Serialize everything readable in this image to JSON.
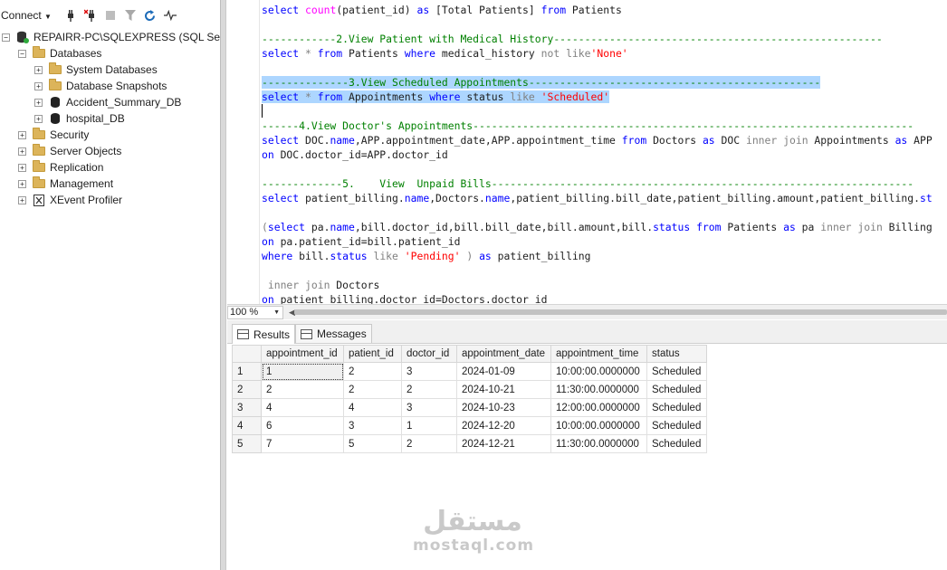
{
  "explorer": {
    "connect_label": "Connect",
    "toolbar_icons": [
      "connect-plug-icon",
      "disconnect-plug-icon",
      "stop-icon",
      "filter-icon",
      "refresh-icon",
      "activity-monitor-icon"
    ],
    "server": "REPAIRR-PC\\SQLEXPRESS (SQL Server",
    "databases_label": "Databases",
    "databases": [
      "System Databases",
      "Database Snapshots",
      "Accident_Summary_DB",
      "hospital_DB"
    ],
    "folders": [
      "Security",
      "Server Objects",
      "Replication",
      "Management"
    ],
    "xevent_label": "XEvent Profiler"
  },
  "editor": {
    "lines": [
      [
        "select ",
        "count",
        "(patient_id) ",
        "as",
        " [Total Patients] ",
        "from",
        " Patients"
      ],
      [
        "------------2.View Patient with Medical History-----------------------------------------------------"
      ],
      [
        "select ",
        "*",
        " from",
        " Patients ",
        "where",
        " medical_history ",
        "not like",
        "'None'"
      ],
      [
        "--------------3.View Scheduled Appointments-----------------------------------------------"
      ],
      [
        "select ",
        "*",
        " from",
        " Appointments ",
        "where",
        " status ",
        "like",
        " 'Scheduled'"
      ],
      [
        "------4.View Doctor's Appointments-----------------------------------------------------------------------"
      ],
      [
        "select",
        " DOC.",
        "name",
        ",APP.appointment_date,APP.appointment_time ",
        "from",
        " Doctors ",
        "as",
        " DOC ",
        "inner join",
        " Appointments ",
        "as",
        " APP"
      ],
      [
        "on",
        " DOC.doctor_id=APP.doctor_id"
      ],
      [
        "-------------5.    View  Unpaid Bills--------------------------------------------------------------------"
      ],
      [
        "select",
        " patient_billing.",
        "name",
        ",Doctors.",
        "name",
        ",patient_billing.bill_date,patient_billing.amount,patient_billing.",
        "st"
      ],
      [
        "(",
        "select",
        " pa.",
        "name",
        ",bill.doctor_id,bill.bill_date,bill.amount,bill.",
        "status",
        " ",
        "from",
        " Patients ",
        "as",
        " pa ",
        "inner join",
        " Billing"
      ],
      [
        "on",
        " pa.patient_id=bill.patient_id"
      ],
      [
        "where",
        " bill.",
        "status",
        " ",
        "like",
        " ",
        "'Pending'",
        " ) ",
        "as",
        " patient_billing"
      ],
      [
        " ",
        "inner join",
        " Doctors"
      ],
      [
        "on",
        " patient_billing.doctor_id=Doctors.doctor_id"
      ]
    ]
  },
  "zoom": {
    "value": "100 %"
  },
  "results": {
    "tabs": [
      "Results",
      "Messages"
    ],
    "columns": [
      "appointment_id",
      "patient_id",
      "doctor_id",
      "appointment_date",
      "appointment_time",
      "status"
    ],
    "rows": [
      [
        "1",
        "1",
        "2",
        "3",
        "2024-01-09",
        "10:00:00.0000000",
        "Scheduled"
      ],
      [
        "2",
        "2",
        "2",
        "2",
        "2024-10-21",
        "11:30:00.0000000",
        "Scheduled"
      ],
      [
        "3",
        "4",
        "4",
        "3",
        "2024-10-23",
        "12:00:00.0000000",
        "Scheduled"
      ],
      [
        "4",
        "6",
        "3",
        "1",
        "2024-12-20",
        "10:00:00.0000000",
        "Scheduled"
      ],
      [
        "5",
        "7",
        "5",
        "2",
        "2024-12-21",
        "11:30:00.0000000",
        "Scheduled"
      ]
    ]
  },
  "watermark": {
    "arabic": "مستقل",
    "latin": "mostaql.com"
  }
}
